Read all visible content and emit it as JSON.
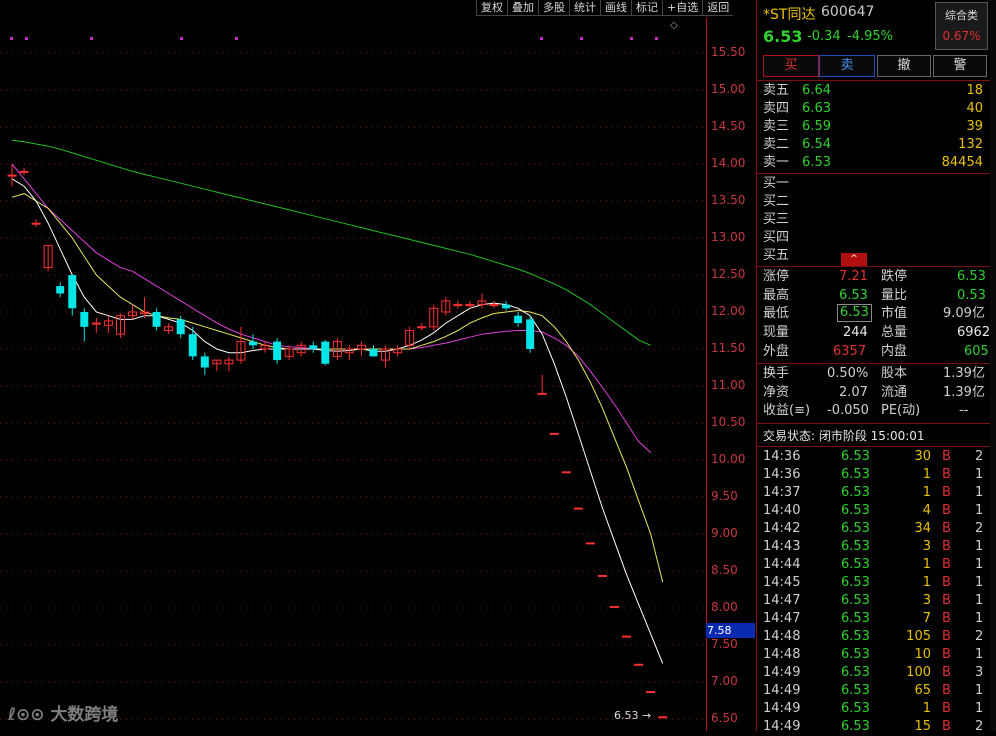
{
  "toolbar": [
    "复权",
    "叠加",
    "多股",
    "统计",
    "画线",
    "标记",
    "+自选",
    "返回"
  ],
  "stock": {
    "name": "*ST同达",
    "code": "600647",
    "price": "6.53",
    "change": "-0.34",
    "change_pct": "-4.95%"
  },
  "sector": {
    "name": "综合类",
    "pct": "0.67%"
  },
  "trade_buttons": {
    "buy": "买",
    "sell": "卖",
    "cancel": "撤",
    "alert": "警"
  },
  "asks": [
    {
      "label": "卖五",
      "price": "6.64",
      "vol": "18"
    },
    {
      "label": "卖四",
      "price": "6.63",
      "vol": "40"
    },
    {
      "label": "卖三",
      "price": "6.59",
      "vol": "39"
    },
    {
      "label": "卖二",
      "price": "6.54",
      "vol": "132"
    },
    {
      "label": "卖一",
      "price": "6.53",
      "vol": "84454"
    }
  ],
  "bids": [
    {
      "label": "买一"
    },
    {
      "label": "买二"
    },
    {
      "label": "买三"
    },
    {
      "label": "买四"
    },
    {
      "label": "买五"
    }
  ],
  "collapse_glyph": "^",
  "quote": {
    "limit_up_l": "涨停",
    "limit_up": "7.21",
    "limit_down_l": "跌停",
    "limit_down": "6.53",
    "high_l": "最高",
    "high": "6.53",
    "vol_ratio_l": "量比",
    "vol_ratio": "0.53",
    "low_l": "最低",
    "low": "6.53",
    "mkt_cap_l": "市值",
    "mkt_cap": "9.09亿",
    "cur_vol_l": "现量",
    "cur_vol": "244",
    "total_vol_l": "总量",
    "total_vol": "6962",
    "outer_l": "外盘",
    "outer": "6357",
    "inner_l": "内盘",
    "inner": "605",
    "turnover_l": "换手",
    "turnover": "0.50%",
    "share_cap_l": "股本",
    "share_cap": "1.39亿",
    "nav_l": "净资",
    "nav": "2.07",
    "float_l": "流通",
    "float": "1.39亿",
    "eps_l": "收益(≡)",
    "eps": "-0.050",
    "pe_l": "PE(动)",
    "pe": "--"
  },
  "status": "交易状态: 闭市阶段 15:00:01",
  "ticks": [
    {
      "time": "14:36",
      "price": "6.53",
      "vol": "30",
      "bs": "B",
      "n": "2"
    },
    {
      "time": "14:36",
      "price": "6.53",
      "vol": "1",
      "bs": "B",
      "n": "1"
    },
    {
      "time": "14:37",
      "price": "6.53",
      "vol": "1",
      "bs": "B",
      "n": "1"
    },
    {
      "time": "14:40",
      "price": "6.53",
      "vol": "4",
      "bs": "B",
      "n": "1"
    },
    {
      "time": "14:42",
      "price": "6.53",
      "vol": "34",
      "bs": "B",
      "n": "2"
    },
    {
      "time": "14:43",
      "price": "6.53",
      "vol": "3",
      "bs": "B",
      "n": "1"
    },
    {
      "time": "14:44",
      "price": "6.53",
      "vol": "1",
      "bs": "B",
      "n": "1"
    },
    {
      "time": "14:45",
      "price": "6.53",
      "vol": "1",
      "bs": "B",
      "n": "1"
    },
    {
      "time": "14:47",
      "price": "6.53",
      "vol": "3",
      "bs": "B",
      "n": "1"
    },
    {
      "time": "14:47",
      "price": "6.53",
      "vol": "7",
      "bs": "B",
      "n": "1"
    },
    {
      "time": "14:48",
      "price": "6.53",
      "vol": "105",
      "bs": "B",
      "n": "2"
    },
    {
      "time": "14:48",
      "price": "6.53",
      "vol": "10",
      "bs": "B",
      "n": "1"
    },
    {
      "time": "14:49",
      "price": "6.53",
      "vol": "100",
      "bs": "B",
      "n": "3"
    },
    {
      "time": "14:49",
      "price": "6.53",
      "vol": "65",
      "bs": "B",
      "n": "1"
    },
    {
      "time": "14:49",
      "price": "6.53",
      "vol": "1",
      "bs": "B",
      "n": "1"
    },
    {
      "time": "14:49",
      "price": "6.53",
      "vol": "15",
      "bs": "B",
      "n": "2"
    }
  ],
  "price_axis": [
    "15.50",
    "15.00",
    "14.50",
    "14.00",
    "13.50",
    "13.00",
    "12.50",
    "12.00",
    "11.50",
    "11.00",
    "10.50",
    "10.00",
    "9.50",
    "9.00",
    "8.50",
    "8.00",
    "7.50",
    "7.00",
    "6.50"
  ],
  "current_price_tag": "7.58",
  "low_label": "6.53",
  "watermark": "大数跨境",
  "colors": {
    "up": "#ff3030",
    "down": "#00e5e5",
    "ma5": "#ffffff",
    "ma10": "#e8e860",
    "ma20": "#e040e0",
    "ma60": "#20c020",
    "grid": "#8b1010"
  },
  "chart_data": {
    "type": "candlestick",
    "ylim": [
      6.5,
      15.75
    ],
    "candles": [
      {
        "o": 13.85,
        "h": 14.0,
        "l": 13.7,
        "c": 13.85
      },
      {
        "o": 13.9,
        "h": 13.95,
        "l": 13.85,
        "c": 13.9
      },
      {
        "o": 13.2,
        "h": 13.25,
        "l": 13.15,
        "c": 13.2
      },
      {
        "o": 12.6,
        "h": 12.9,
        "l": 12.55,
        "c": 12.9
      },
      {
        "o": 12.35,
        "h": 12.4,
        "l": 12.2,
        "c": 12.25
      },
      {
        "o": 12.5,
        "h": 12.5,
        "l": 11.95,
        "c": 12.05
      },
      {
        "o": 12.0,
        "h": 12.05,
        "l": 11.6,
        "c": 11.8
      },
      {
        "o": 11.85,
        "h": 11.92,
        "l": 11.72,
        "c": 11.85
      },
      {
        "o": 11.82,
        "h": 11.95,
        "l": 11.72,
        "c": 11.88
      },
      {
        "o": 11.7,
        "h": 11.98,
        "l": 11.65,
        "c": 11.95
      },
      {
        "o": 11.95,
        "h": 12.1,
        "l": 11.9,
        "c": 12.0
      },
      {
        "o": 11.98,
        "h": 12.2,
        "l": 11.92,
        "c": 12.0
      },
      {
        "o": 12.0,
        "h": 12.05,
        "l": 11.75,
        "c": 11.8
      },
      {
        "o": 11.75,
        "h": 11.85,
        "l": 11.7,
        "c": 11.8
      },
      {
        "o": 11.9,
        "h": 11.95,
        "l": 11.65,
        "c": 11.7
      },
      {
        "o": 11.7,
        "h": 11.8,
        "l": 11.35,
        "c": 11.4
      },
      {
        "o": 11.4,
        "h": 11.45,
        "l": 11.15,
        "c": 11.25
      },
      {
        "o": 11.3,
        "h": 11.35,
        "l": 11.2,
        "c": 11.35
      },
      {
        "o": 11.3,
        "h": 11.4,
        "l": 11.2,
        "c": 11.35
      },
      {
        "o": 11.35,
        "h": 11.8,
        "l": 11.3,
        "c": 11.6
      },
      {
        "o": 11.6,
        "h": 11.7,
        "l": 11.5,
        "c": 11.55
      },
      {
        "o": 11.5,
        "h": 11.6,
        "l": 11.45,
        "c": 11.55
      },
      {
        "o": 11.6,
        "h": 11.65,
        "l": 11.3,
        "c": 11.35
      },
      {
        "o": 11.4,
        "h": 11.55,
        "l": 11.35,
        "c": 11.5
      },
      {
        "o": 11.45,
        "h": 11.6,
        "l": 11.4,
        "c": 11.55
      },
      {
        "o": 11.55,
        "h": 11.6,
        "l": 11.45,
        "c": 11.5
      },
      {
        "o": 11.6,
        "h": 11.62,
        "l": 11.28,
        "c": 11.3
      },
      {
        "o": 11.4,
        "h": 11.65,
        "l": 11.35,
        "c": 11.6
      },
      {
        "o": 11.45,
        "h": 11.55,
        "l": 11.35,
        "c": 11.5
      },
      {
        "o": 11.5,
        "h": 11.6,
        "l": 11.4,
        "c": 11.55
      },
      {
        "o": 11.5,
        "h": 11.55,
        "l": 11.4,
        "c": 11.4
      },
      {
        "o": 11.35,
        "h": 11.55,
        "l": 11.25,
        "c": 11.5
      },
      {
        "o": 11.45,
        "h": 11.55,
        "l": 11.4,
        "c": 11.5
      },
      {
        "o": 11.55,
        "h": 11.8,
        "l": 11.5,
        "c": 11.75
      },
      {
        "o": 11.8,
        "h": 11.85,
        "l": 11.75,
        "c": 11.8
      },
      {
        "o": 11.8,
        "h": 12.1,
        "l": 11.75,
        "c": 12.05
      },
      {
        "o": 12.0,
        "h": 12.2,
        "l": 11.95,
        "c": 12.15
      },
      {
        "o": 12.1,
        "h": 12.15,
        "l": 12.05,
        "c": 12.1
      },
      {
        "o": 12.1,
        "h": 12.15,
        "l": 12.05,
        "c": 12.1
      },
      {
        "o": 12.1,
        "h": 12.25,
        "l": 12.05,
        "c": 12.15
      },
      {
        "o": 12.1,
        "h": 12.15,
        "l": 12.05,
        "c": 12.1
      },
      {
        "o": 12.1,
        "h": 12.15,
        "l": 12.02,
        "c": 12.05
      },
      {
        "o": 11.95,
        "h": 12.0,
        "l": 11.8,
        "c": 11.85
      },
      {
        "o": 11.9,
        "h": 11.95,
        "l": 11.45,
        "c": 11.5
      },
      {
        "o": 10.9,
        "h": 11.15,
        "l": 10.9,
        "c": 10.9
      },
      {
        "o": 10.36,
        "h": 10.36,
        "l": 10.36,
        "c": 10.36
      },
      {
        "o": 9.84,
        "h": 9.84,
        "l": 9.84,
        "c": 9.84
      },
      {
        "o": 9.35,
        "h": 9.35,
        "l": 9.35,
        "c": 9.35
      },
      {
        "o": 8.88,
        "h": 8.88,
        "l": 8.88,
        "c": 8.88
      },
      {
        "o": 8.44,
        "h": 8.44,
        "l": 8.44,
        "c": 8.44
      },
      {
        "o": 8.02,
        "h": 8.02,
        "l": 8.02,
        "c": 8.02
      },
      {
        "o": 7.62,
        "h": 7.62,
        "l": 7.62,
        "c": 7.62
      },
      {
        "o": 7.24,
        "h": 7.24,
        "l": 7.24,
        "c": 7.24
      },
      {
        "o": 6.87,
        "h": 6.87,
        "l": 6.87,
        "c": 6.87
      },
      {
        "o": 6.53,
        "h": 6.53,
        "l": 6.53,
        "c": 6.53
      }
    ],
    "ma5": [
      13.8,
      13.7,
      13.5,
      13.2,
      12.85,
      12.5,
      12.2,
      12.0,
      11.95,
      11.9,
      11.9,
      11.95,
      11.95,
      11.9,
      11.85,
      11.75,
      11.6,
      11.5,
      11.45,
      11.45,
      11.48,
      11.5,
      11.5,
      11.5,
      11.5,
      11.5,
      11.48,
      11.47,
      11.48,
      11.5,
      11.47,
      11.47,
      11.5,
      11.55,
      11.62,
      11.72,
      11.85,
      11.95,
      12.05,
      12.1,
      12.12,
      12.1,
      12.05,
      11.95,
      11.7,
      11.3,
      10.85,
      10.35,
      9.85,
      9.35,
      8.9,
      8.45,
      8.05,
      7.65,
      7.25
    ],
    "ma10": [
      13.55,
      13.6,
      13.5,
      13.4,
      13.2,
      13.0,
      12.75,
      12.5,
      12.35,
      12.2,
      12.1,
      12.0,
      11.95,
      11.92,
      11.9,
      11.85,
      11.8,
      11.75,
      11.7,
      11.65,
      11.6,
      11.55,
      11.52,
      11.5,
      11.5,
      11.5,
      11.5,
      11.5,
      11.5,
      11.5,
      11.5,
      11.5,
      11.5,
      11.5,
      11.55,
      11.6,
      11.67,
      11.75,
      11.85,
      11.92,
      11.98,
      12.0,
      12.02,
      12.0,
      11.95,
      11.8,
      11.6,
      11.35,
      11.05,
      10.7,
      10.3,
      9.9,
      9.45,
      9.0,
      8.35
    ],
    "ma20": [
      14.0,
      13.8,
      13.6,
      13.4,
      13.25,
      13.1,
      12.95,
      12.8,
      12.7,
      12.6,
      12.55,
      12.45,
      12.35,
      12.25,
      12.15,
      12.05,
      11.95,
      11.85,
      11.77,
      11.7,
      11.65,
      11.6,
      11.55,
      11.53,
      11.52,
      11.5,
      11.5,
      11.5,
      11.5,
      11.5,
      11.5,
      11.5,
      11.5,
      11.5,
      11.52,
      11.55,
      11.58,
      11.62,
      11.66,
      11.7,
      11.72,
      11.74,
      11.75,
      11.75,
      11.73,
      11.65,
      11.55,
      11.4,
      11.2,
      10.98,
      10.75,
      10.5,
      10.25,
      10.1
    ],
    "ma60": [
      14.32,
      14.3,
      14.27,
      14.24,
      14.2,
      14.15,
      14.1,
      14.05,
      14.0,
      13.95,
      13.9,
      13.86,
      13.82,
      13.78,
      13.74,
      13.7,
      13.66,
      13.62,
      13.58,
      13.54,
      13.5,
      13.46,
      13.42,
      13.38,
      13.34,
      13.3,
      13.26,
      13.22,
      13.18,
      13.14,
      13.1,
      13.06,
      13.02,
      12.98,
      12.94,
      12.9,
      12.86,
      12.82,
      12.78,
      12.73,
      12.68,
      12.63,
      12.58,
      12.52,
      12.45,
      12.38,
      12.3,
      12.2,
      12.1,
      11.98,
      11.86,
      11.74,
      11.62,
      11.55
    ]
  }
}
